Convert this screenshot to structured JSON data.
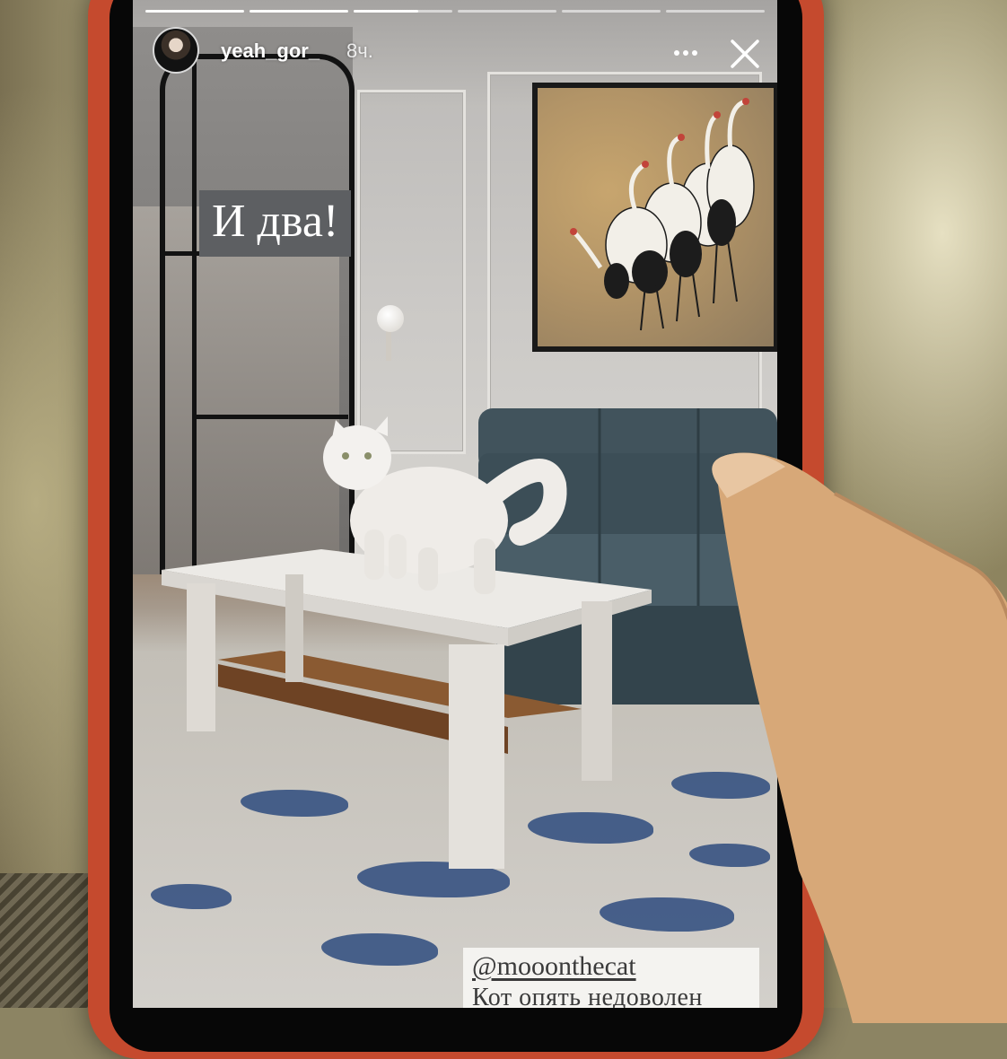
{
  "story": {
    "progress_segments": [
      {
        "state": "done"
      },
      {
        "state": "done"
      },
      {
        "state": "current",
        "fill": 0.65
      },
      {
        "state": "pending"
      },
      {
        "state": "pending"
      },
      {
        "state": "pending"
      }
    ],
    "header": {
      "username": "yeah_gor_",
      "timestamp": "8ч.",
      "avatar_icon": "profile-avatar",
      "more_icon": "more-dots-icon",
      "close_icon": "close-icon"
    },
    "sticker_text": "И два!",
    "caption": {
      "mention": "@mooonthecat",
      "text": "Кот опять недоволен"
    }
  },
  "colors": {
    "phone_case": "#c54a2e",
    "sticker_bg": "#5d5f62",
    "caption_bg": "#f4f3f0"
  }
}
